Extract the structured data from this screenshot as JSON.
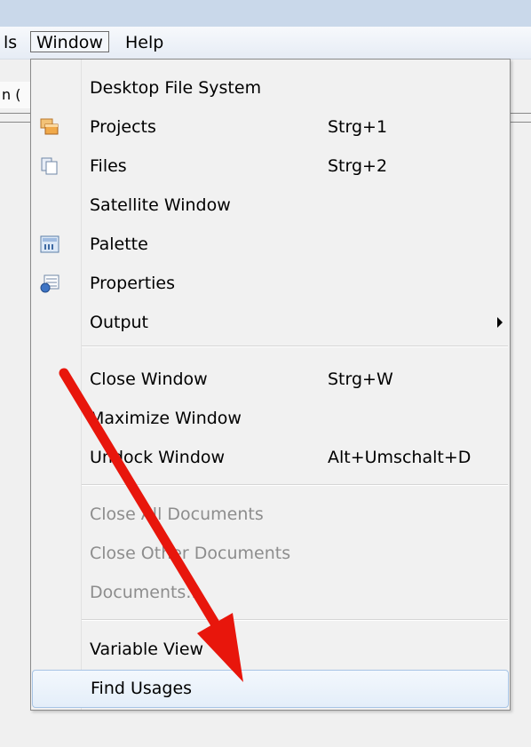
{
  "menubar": {
    "items": [
      {
        "label": "ls"
      },
      {
        "label": "Window"
      },
      {
        "label": "Help"
      }
    ]
  },
  "background": {
    "partial_tab_text": "n ("
  },
  "window_menu": {
    "items": [
      {
        "label": "Desktop File System",
        "shortcut": "",
        "icon": "",
        "enabled": true
      },
      {
        "label": "Projects",
        "shortcut": "Strg+1",
        "icon": "projects-icon",
        "enabled": true
      },
      {
        "label": "Files",
        "shortcut": "Strg+2",
        "icon": "files-icon",
        "enabled": true
      },
      {
        "label": "Satellite Window",
        "shortcut": "",
        "icon": "",
        "enabled": true
      },
      {
        "label": "Palette",
        "shortcut": "",
        "icon": "palette-icon",
        "enabled": true
      },
      {
        "label": "Properties",
        "shortcut": "",
        "icon": "properties-icon",
        "enabled": true
      },
      {
        "label": "Output",
        "shortcut": "",
        "icon": "",
        "enabled": true,
        "submenu": true
      },
      {
        "label": "Close Window",
        "shortcut": "Strg+W",
        "icon": "",
        "enabled": true
      },
      {
        "label": "Maximize Window",
        "shortcut": "",
        "icon": "",
        "enabled": true
      },
      {
        "label": "Undock Window",
        "shortcut": "Alt+Umschalt+D",
        "icon": "",
        "enabled": true
      },
      {
        "label": "Close All Documents",
        "shortcut": "",
        "icon": "",
        "enabled": false
      },
      {
        "label": "Close Other Documents",
        "shortcut": "",
        "icon": "",
        "enabled": false
      },
      {
        "label": "Documents...",
        "shortcut": "",
        "icon": "",
        "enabled": false
      },
      {
        "label": "Variable View",
        "shortcut": "",
        "icon": "",
        "enabled": true
      },
      {
        "label": "Find Usages",
        "shortcut": "",
        "icon": "",
        "enabled": true,
        "highlighted": true
      }
    ]
  },
  "annotation": {
    "arrow_color": "#e8160c",
    "points_to": "Find Usages"
  },
  "colors": {
    "menu_bg": "#f1f1f1",
    "highlight_border": "#a7c4e5",
    "disabled_text": "#8d8d8d",
    "menubar_bg": "#c9d8ea"
  }
}
